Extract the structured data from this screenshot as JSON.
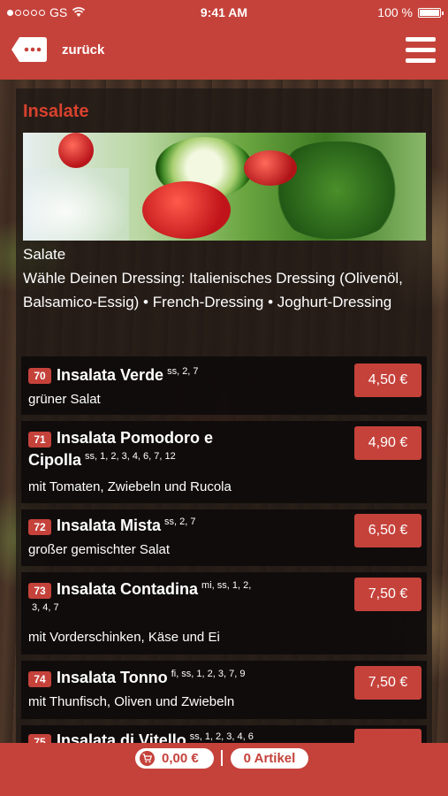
{
  "status": {
    "carrier": "GS",
    "time": "9:41 AM",
    "battery": "100 %"
  },
  "nav": {
    "back_label": "zurück"
  },
  "section": {
    "title": "Insalate",
    "description_title": "Salate",
    "description": "Wähle Deinen Dressing: Italienisches Dressing (Olivenöl, Balsamico-Essig) • French-Dressing • Joghurt-Dressing"
  },
  "items": [
    {
      "num": "70",
      "name": "Insalata Verde",
      "allergens": "ss, 2, 7",
      "desc": "grüner Salat",
      "price": "4,50 €"
    },
    {
      "num": "71",
      "name": "Insalata Pomodoro e",
      "name2": "Cipolla",
      "allergens": "ss, 1, 2, 3, 4, 6, 7, 12",
      "desc": "mit Tomaten, Zwiebeln und Rucola",
      "price": "4,90 €"
    },
    {
      "num": "72",
      "name": "Insalata Mista",
      "allergens": "ss, 2, 7",
      "desc": "großer gemischter Salat",
      "price": "6,50 €"
    },
    {
      "num": "73",
      "name": "Insalata Contadina",
      "allergens": "mi, ss, 1, 2,",
      "allergens2": "3, 4, 7",
      "desc": "mit Vorderschinken, Käse und Ei",
      "price": "7,50 €"
    },
    {
      "num": "74",
      "name": "Insalata Tonno",
      "allergens": "fi, ss, 1, 2, 3, 7, 9",
      "desc": "mit Thunfisch, Oliven und Zwiebeln",
      "price": "7,50 €"
    },
    {
      "num": "75",
      "name": "Insalata di Vitello",
      "allergens": "ss, 1, 2, 3, 4, 6",
      "price": ""
    }
  ],
  "footer": {
    "total": "0,00 €",
    "count": "0 Artikel"
  },
  "colors": {
    "accent": "#c5423b",
    "title_red": "#d8422e"
  }
}
